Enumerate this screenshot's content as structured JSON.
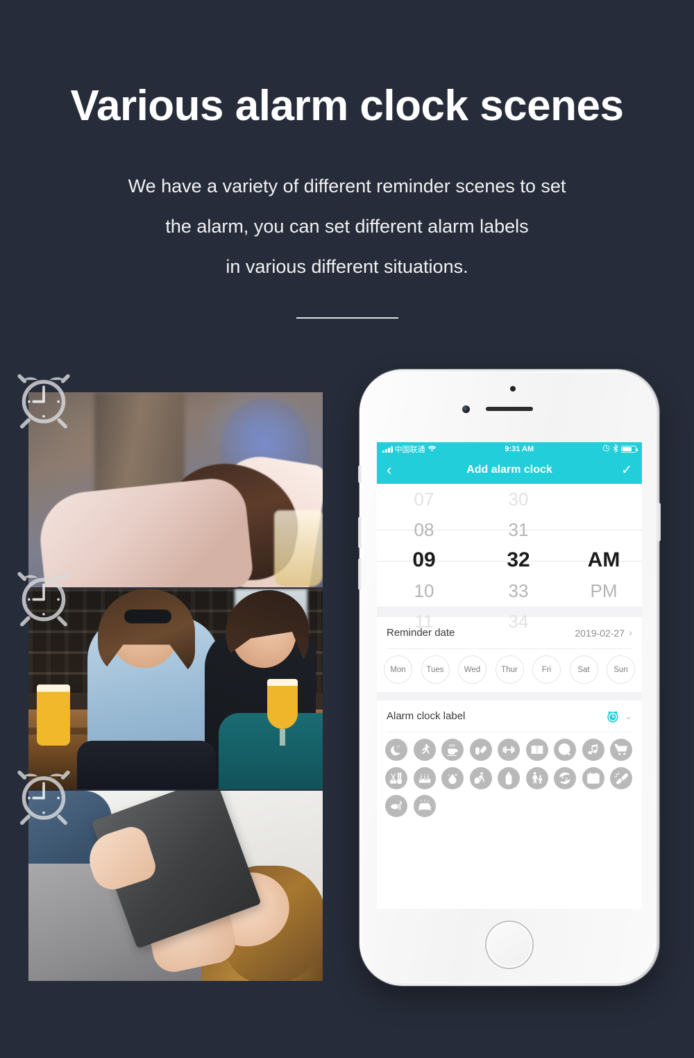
{
  "theme": {
    "background": "#272c3a",
    "accent": "#22ced9",
    "heading_color": "#ffffff"
  },
  "hero": {
    "title": "Various alarm clock scenes",
    "subtitle_lines": [
      "We have a variety of different reminder scenes to set",
      "the alarm, you can set different alarm labels",
      "in various different situations."
    ]
  },
  "photos": [
    {
      "name": "photo-woman-sleeping-at-table",
      "alt": "Woman asleep resting her head on her arms at a cafe table"
    },
    {
      "name": "photo-two-women-laughing-with-beer",
      "alt": "Two women laughing together holding beer glasses at a bar"
    },
    {
      "name": "photo-woman-lying-with-book-on-face",
      "alt": "Woman lying on a bed with an open book over her face"
    }
  ],
  "decor": {
    "clock_icons": [
      "alarm-clock-watermark-1",
      "alarm-clock-watermark-2",
      "alarm-clock-watermark-3"
    ]
  },
  "phone": {
    "status_bar": {
      "carrier": "中国联通",
      "time": "9:31 AM",
      "signal_icon": "signal-bars-icon",
      "wifi_icon": "wifi-icon",
      "alarm_icon": "alarm-indicator-icon",
      "bluetooth_icon": "bluetooth-icon",
      "battery_icon": "battery-icon"
    },
    "nav": {
      "back_icon": "chevron-left-icon",
      "title": "Add alarm clock",
      "confirm_icon": "checkmark-icon"
    },
    "time_picker": {
      "hours": [
        "07",
        "08",
        "09",
        "10",
        "11"
      ],
      "minutes": [
        "30",
        "31",
        "32",
        "33",
        "34"
      ],
      "meridiems": [
        "AM",
        "PM"
      ],
      "selected_hour": "09",
      "selected_minute": "32",
      "selected_meridiem": "AM"
    },
    "reminder_date": {
      "label": "Reminder date",
      "value": "2019-02-27",
      "chevron": "›"
    },
    "days": [
      {
        "label": "Mon",
        "selected": false
      },
      {
        "label": "Tues",
        "selected": false
      },
      {
        "label": "Wed",
        "selected": false
      },
      {
        "label": "Thur",
        "selected": false
      },
      {
        "label": "Fri",
        "selected": false
      },
      {
        "label": "Sat",
        "selected": false
      },
      {
        "label": "Sun",
        "selected": false
      }
    ],
    "alarm_label": {
      "label": "Alarm clock label",
      "selected_icon": "alarm-clock-icon",
      "expand_icon": "chevron-down-icon"
    },
    "label_icons": [
      {
        "name": "sleep-icon"
      },
      {
        "name": "running-icon"
      },
      {
        "name": "coffee-icon"
      },
      {
        "name": "medicine-icon"
      },
      {
        "name": "gym-icon"
      },
      {
        "name": "reading-book-icon"
      },
      {
        "name": "movie-reel-icon"
      },
      {
        "name": "music-icon"
      },
      {
        "name": "shopping-cart-icon"
      },
      {
        "name": "haircut-icon"
      },
      {
        "name": "birthday-cake-icon"
      },
      {
        "name": "wedding-ring-icon"
      },
      {
        "name": "travel-luggage-icon"
      },
      {
        "name": "baby-bottle-icon"
      },
      {
        "name": "pick-up-child-icon"
      },
      {
        "name": "currency-exchange-icon"
      },
      {
        "name": "medical-checkup-icon"
      },
      {
        "name": "cleaning-icon"
      },
      {
        "name": "fishing-icon"
      },
      {
        "name": "car-wash-icon"
      }
    ],
    "home_button": "home-button"
  }
}
